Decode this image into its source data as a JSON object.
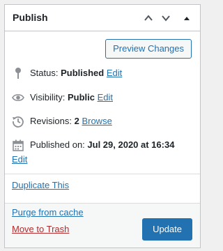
{
  "panel": {
    "title": "Publish",
    "controls": {
      "move_up_icon": "chevron-up-icon",
      "move_down_icon": "chevron-down-icon",
      "toggle_icon": "triangle-up-icon"
    }
  },
  "preview_button": {
    "label": "Preview Changes"
  },
  "status": {
    "icon": "pin-icon",
    "label": "Status:",
    "value": "Published",
    "edit_link": "Edit"
  },
  "visibility": {
    "icon": "eye-icon",
    "label": "Visibility:",
    "value": "Public",
    "edit_link": "Edit"
  },
  "revisions": {
    "icon": "history-icon",
    "label": "Revisions:",
    "value": "2",
    "browse_link": "Browse"
  },
  "published_on": {
    "icon": "calendar-icon",
    "label": "Published on:",
    "value": "Jul 29, 2020 at 16:34",
    "edit_link": "Edit"
  },
  "duplicate_link": "Duplicate This",
  "purge_link": "Purge from cache",
  "trash_link": "Move to Trash",
  "update_button": {
    "label": "Update"
  },
  "colors": {
    "accent": "#2271b1",
    "danger": "#b32d2e",
    "border": "#c3c4c7",
    "background": "#f0f0f1"
  }
}
